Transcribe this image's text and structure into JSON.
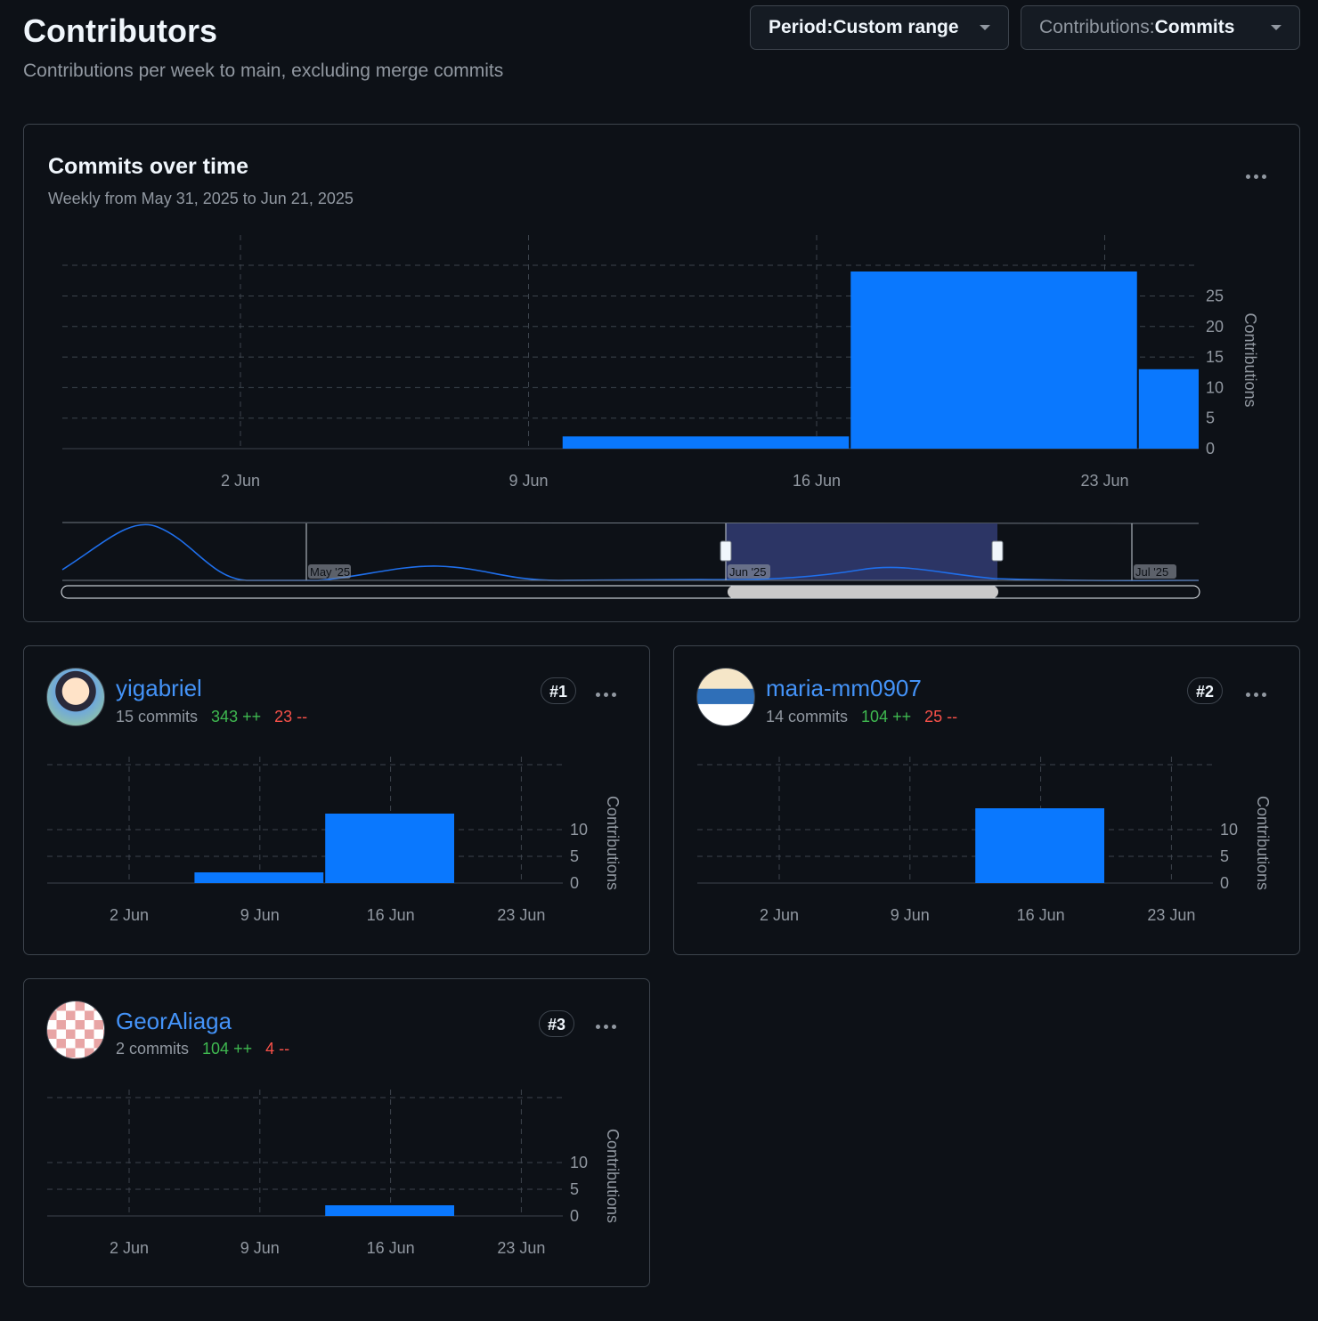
{
  "header": {
    "title": "Contributors",
    "subtitle": "Contributions per week to main, excluding merge commits",
    "period_prefix": "Period: ",
    "period_value": "Custom range",
    "contrib_prefix": "Contributions: ",
    "contrib_value": "Commits"
  },
  "main_chart": {
    "title": "Commits over time",
    "subtitle": "Weekly from May 31, 2025 to Jun 21, 2025"
  },
  "colors": {
    "bar": "#0a78fe",
    "accent_link": "#4493f8",
    "additions": "#3fb950",
    "deletions": "#f85149",
    "grid": "#3d444d",
    "selection": "#2c3565"
  },
  "icons": {
    "kebab": "kebab-horizontal-icon",
    "caret": "triangle-down-icon"
  },
  "chart_data": [
    {
      "id": "commits-over-time",
      "type": "bar",
      "title": "Commits over time",
      "xlabel": "",
      "ylabel": "Contributions",
      "x_ticks": [
        "2 Jun",
        "9 Jun",
        "16 Jun",
        "23 Jun"
      ],
      "y_ticks": [
        0,
        5,
        10,
        15,
        20,
        25
      ],
      "ylim": [
        0,
        29
      ],
      "grid": true,
      "bars": [
        {
          "week": "2 Jun",
          "value": 0
        },
        {
          "week": "9 Jun",
          "value": 2
        },
        {
          "week": "16 Jun",
          "value": 29
        },
        {
          "week": "23 Jun",
          "value": 13
        }
      ],
      "navigator": {
        "labels": [
          "May '25",
          "Jun '25",
          "Jul '25"
        ],
        "selected_range": [
          "Jun '25",
          "Jun 21, 2025"
        ]
      }
    },
    {
      "id": "yigabriel",
      "type": "bar",
      "ylabel": "Contributions",
      "x_ticks": [
        "2 Jun",
        "9 Jun",
        "16 Jun",
        "23 Jun"
      ],
      "y_ticks": [
        0,
        5,
        10
      ],
      "ylim": [
        0,
        15
      ],
      "grid": true,
      "bars": [
        {
          "week": "2 Jun",
          "value": 0
        },
        {
          "week": "9 Jun",
          "value": 2
        },
        {
          "week": "16 Jun",
          "value": 13
        },
        {
          "week": "23 Jun",
          "value": 0
        }
      ]
    },
    {
      "id": "maria-mm0907",
      "type": "bar",
      "ylabel": "Contributions",
      "x_ticks": [
        "2 Jun",
        "9 Jun",
        "16 Jun",
        "23 Jun"
      ],
      "y_ticks": [
        0,
        5,
        10
      ],
      "ylim": [
        0,
        15
      ],
      "grid": true,
      "bars": [
        {
          "week": "2 Jun",
          "value": 0
        },
        {
          "week": "9 Jun",
          "value": 0
        },
        {
          "week": "16 Jun",
          "value": 14
        },
        {
          "week": "23 Jun",
          "value": 0
        }
      ]
    },
    {
      "id": "GeorAliaga",
      "type": "bar",
      "ylabel": "Contributions",
      "x_ticks": [
        "2 Jun",
        "9 Jun",
        "16 Jun",
        "23 Jun"
      ],
      "y_ticks": [
        0,
        5,
        10
      ],
      "ylim": [
        0,
        15
      ],
      "grid": true,
      "bars": [
        {
          "week": "2 Jun",
          "value": 0
        },
        {
          "week": "9 Jun",
          "value": 0
        },
        {
          "week": "16 Jun",
          "value": 2
        },
        {
          "week": "23 Jun",
          "value": 0
        }
      ]
    }
  ],
  "contributors": [
    {
      "rank": "#1",
      "name": "yigabriel",
      "commits": "15 commits",
      "additions": "343 ++",
      "deletions": "23 --",
      "avatar": "anime-boy-avatar"
    },
    {
      "rank": "#2",
      "name": "maria-mm0907",
      "commits": "14 commits",
      "additions": "104 ++",
      "deletions": "25 --",
      "avatar": "piplup-avatar"
    },
    {
      "rank": "#3",
      "name": "GeorAliaga",
      "commits": "2 commits",
      "additions": "104 ++",
      "deletions": "4 --",
      "avatar": "identicon-avatar"
    }
  ]
}
